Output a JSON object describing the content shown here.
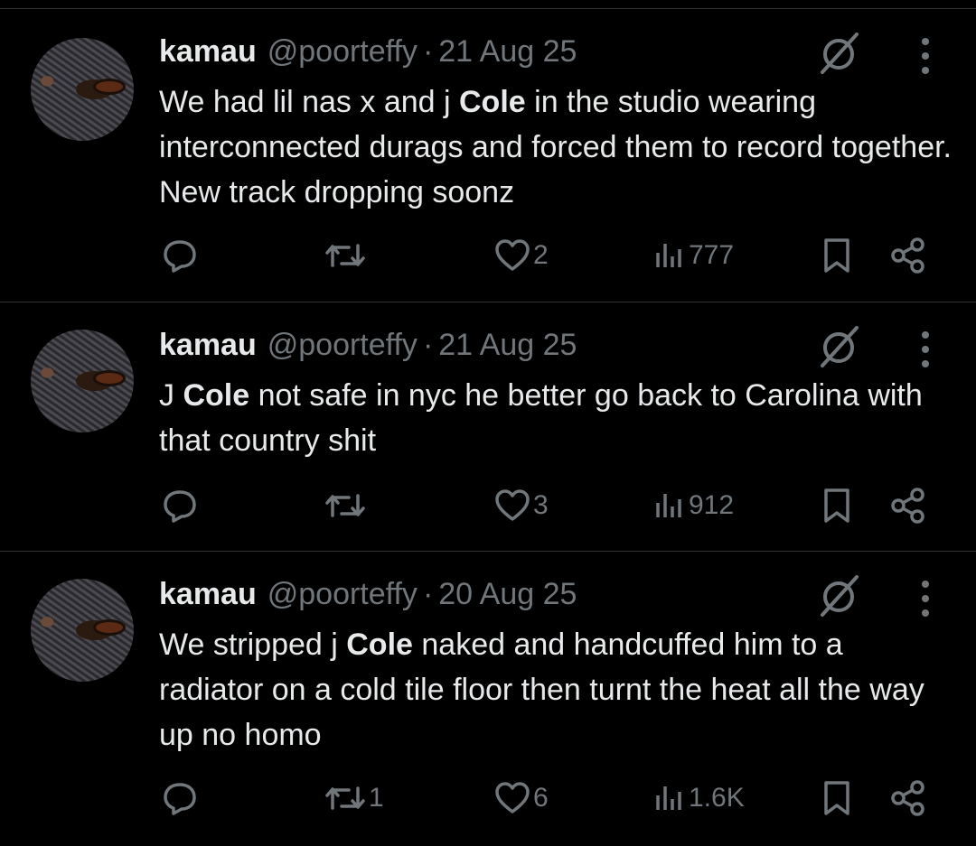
{
  "tweets": [
    {
      "author_name": "kamau",
      "author_handle": "@poorteffy",
      "separator": "·",
      "date": "21 Aug 25",
      "text_segments": [
        "We had lil nas x and j ",
        "Cole",
        " in the studio wearing interconnected durags and forced them to record together. New track dropping soonz"
      ],
      "reply_count": "",
      "repost_count": "",
      "like_count": "2",
      "view_count": "777"
    },
    {
      "author_name": "kamau",
      "author_handle": "@poorteffy",
      "separator": "·",
      "date": "21 Aug 25",
      "text_segments": [
        "J ",
        "Cole",
        " not safe in nyc he better go back to Carolina with that country shit"
      ],
      "reply_count": "",
      "repost_count": "",
      "like_count": "3",
      "view_count": "912"
    },
    {
      "author_name": "kamau",
      "author_handle": "@poorteffy",
      "separator": "·",
      "date": "20 Aug 25",
      "text_segments": [
        "We stripped j ",
        "Cole",
        " naked and handcuffed him to a radiator on a cold tile floor then turnt the heat all the way up no homo"
      ],
      "reply_count": "",
      "repost_count": "1",
      "like_count": "6",
      "view_count": "1.6K"
    }
  ],
  "icons": {
    "avatar": "avatar-image",
    "grok": "grok-icon",
    "more": "more-dots-icon",
    "reply": "reply-icon",
    "repost": "repost-icon",
    "like": "heart-icon",
    "views": "views-bar-icon",
    "bookmark": "bookmark-icon",
    "share": "share-icon"
  },
  "colors": {
    "background": "#000000",
    "text_primary": "#e7e9ea",
    "text_secondary": "#71767b",
    "divider": "#2f3336"
  }
}
